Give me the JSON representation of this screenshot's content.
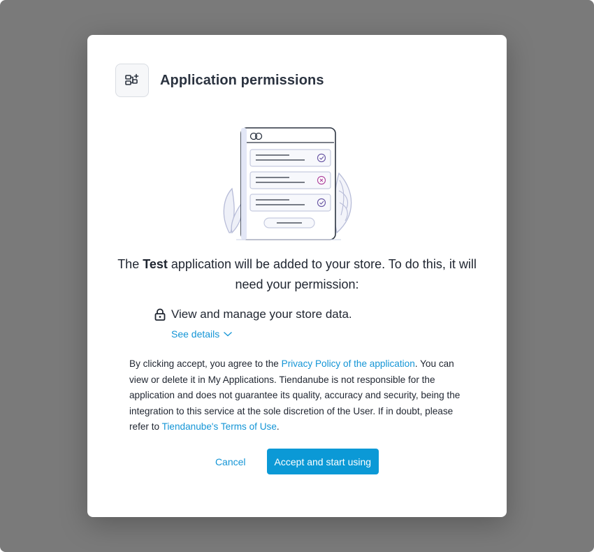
{
  "dialog": {
    "title": "Application permissions",
    "app_icon": "app-grid-plus-icon"
  },
  "intro": {
    "prefix": "The ",
    "app_name": "Test",
    "suffix": " application will be added to your store. To do this, it will need your permission:"
  },
  "permissions": [
    {
      "icon": "lock-icon",
      "label": "View and manage your store data."
    }
  ],
  "see_details": {
    "label": "See details",
    "icon": "chevron-down-icon"
  },
  "legal": {
    "part1": "By clicking accept, you agree to the ",
    "privacy_link": "Privacy Policy of the application",
    "part2": ". You can view or delete it in My Applications. Tiendanube is not responsible for the application and does not guarantee its quality, accuracy and security, being the integration to this service at the sole discretion of the User. If in doubt, please refer to ",
    "terms_link": "Tiendanube's Terms of Use",
    "part3": "."
  },
  "buttons": {
    "cancel": "Cancel",
    "accept": "Accept and start using"
  },
  "colors": {
    "backdrop": "#7a7a7a",
    "link": "#1495d6",
    "primary": "#0b99d6",
    "text": "#1f2530"
  }
}
